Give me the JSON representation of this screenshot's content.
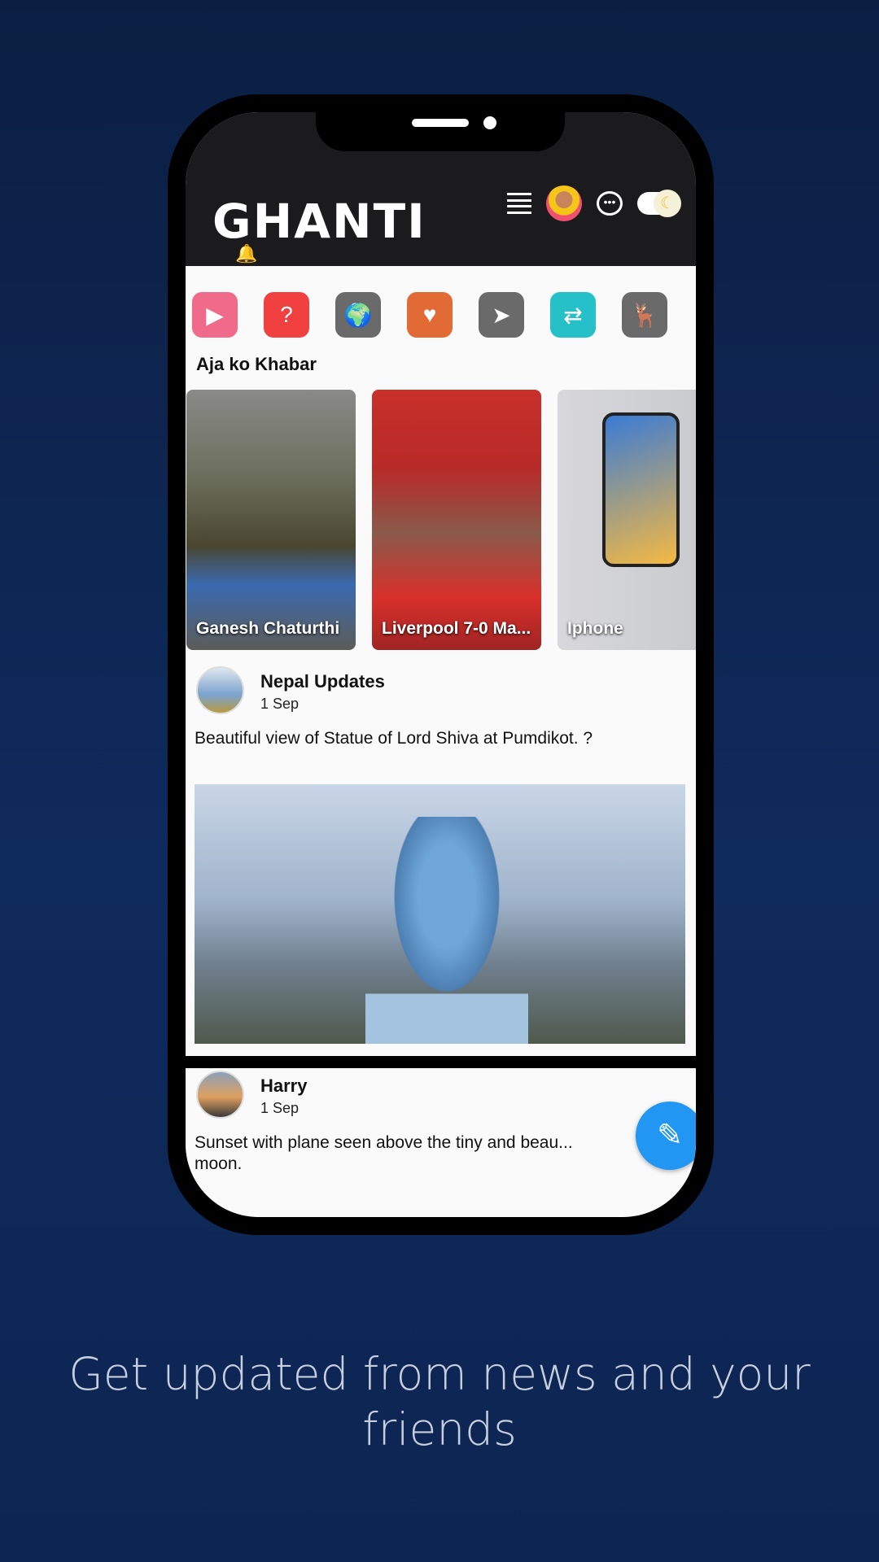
{
  "app": {
    "logo_text": "GHANTI"
  },
  "header": {
    "icons": [
      "menu-icon",
      "profile-avatar",
      "chat-icon",
      "theme-toggle-moon"
    ]
  },
  "categories": [
    {
      "icon": "video-clapper-icon",
      "color": "#f06b8a"
    },
    {
      "icon": "quiz-icon",
      "color": "#f04040"
    },
    {
      "icon": "news-globe-icon",
      "color": "#6a6a6a"
    },
    {
      "icon": "health-heart-icon",
      "color": "#e26a34"
    },
    {
      "icon": "navigation-icon",
      "color": "#6a6a6a"
    },
    {
      "icon": "exchange-globe-icon",
      "color": "#25c0c8"
    },
    {
      "icon": "wildlife-earth-icon",
      "color": "#6a6a6a"
    }
  ],
  "section_title": "Aja ko Khabar",
  "stories": [
    {
      "title": "Ganesh Chaturthi"
    },
    {
      "title": "Liverpool 7-0 Ma..."
    },
    {
      "title": "Iphone"
    }
  ],
  "posts": [
    {
      "author": "Nepal Updates",
      "date": "1 Sep",
      "text": "Beautiful view of Statue of Lord Shiva at Pumdikot. ?"
    },
    {
      "author": "Harry",
      "date": "1 Sep",
      "text": "Sunset with plane seen above the tiny and beau... moon."
    }
  ],
  "fab": {
    "icon": "pencil-icon"
  },
  "caption": "Get updated from news and your friends",
  "colors": {
    "background": "#0f2a5c",
    "accent": "#2196f3",
    "header": "#1b1b1d"
  }
}
